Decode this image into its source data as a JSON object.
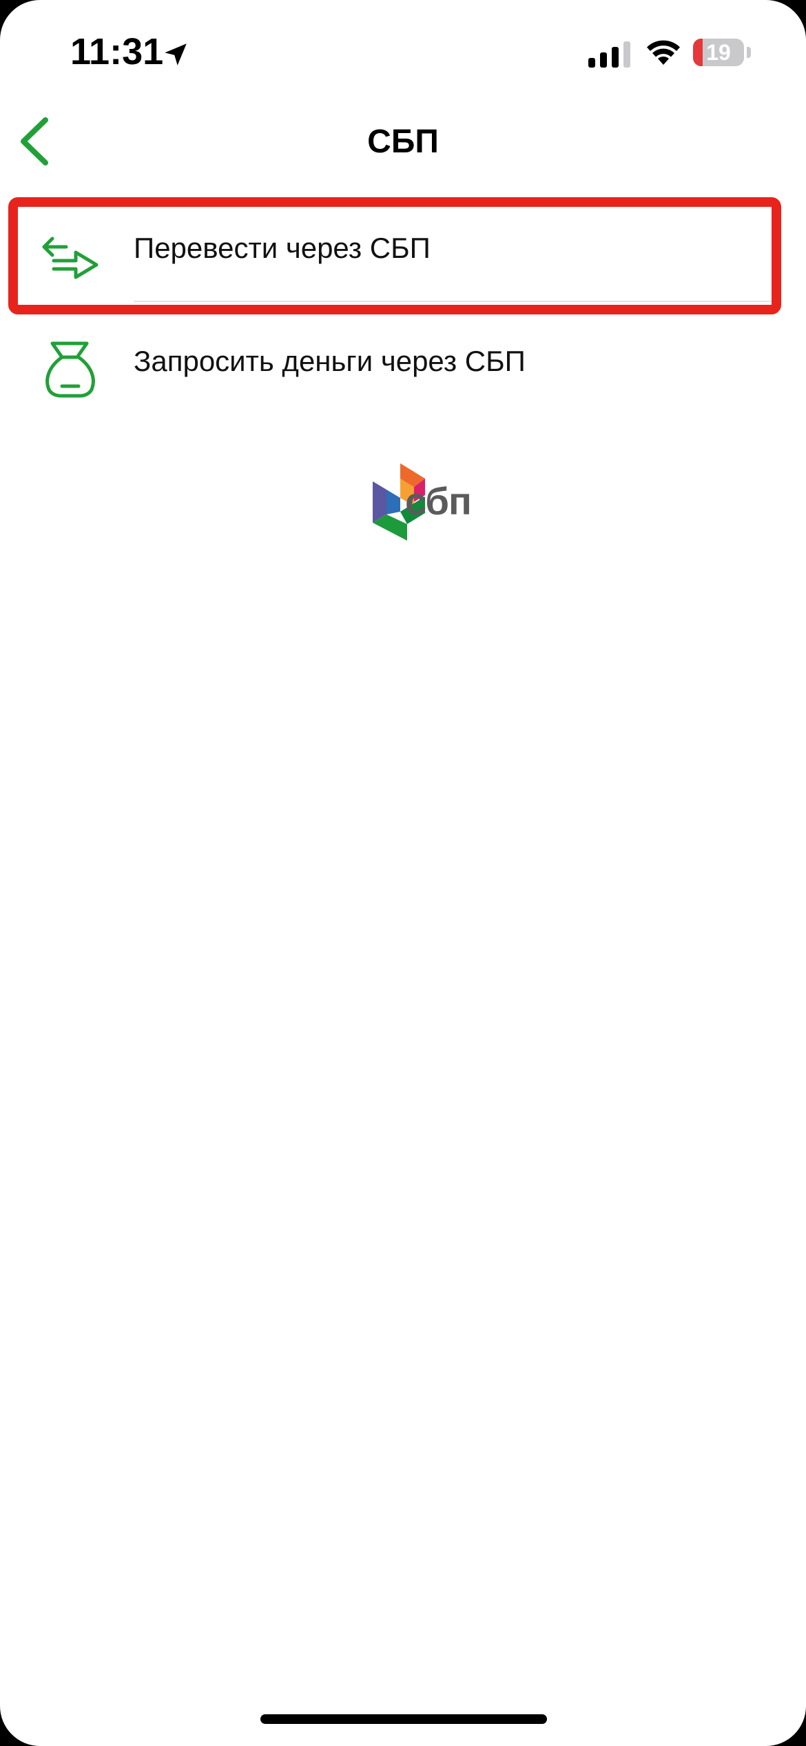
{
  "status_bar": {
    "time": "11:31",
    "battery_level": "19",
    "battery_fraction": 0.19,
    "icons": [
      "location-arrow-icon",
      "cellular-signal-icon",
      "wifi-icon",
      "battery-icon"
    ]
  },
  "nav": {
    "title": "СБП",
    "back_icon": "chevron-left-icon"
  },
  "menu": {
    "items": [
      {
        "label": "Перевести через СБП",
        "icon": "transfer-arrows-icon",
        "highlighted": true
      },
      {
        "label": "Запросить деньги через СБП",
        "icon": "money-bag-icon",
        "highlighted": false
      }
    ]
  },
  "logo": {
    "text": "сбп",
    "icon": "sbp-logo-icon"
  },
  "colors": {
    "accent_green": "#21A038",
    "highlight_red": "#E8231B",
    "text": "#111111",
    "divider": "#E5E5E5",
    "logo_text": "#5B5B5B"
  }
}
